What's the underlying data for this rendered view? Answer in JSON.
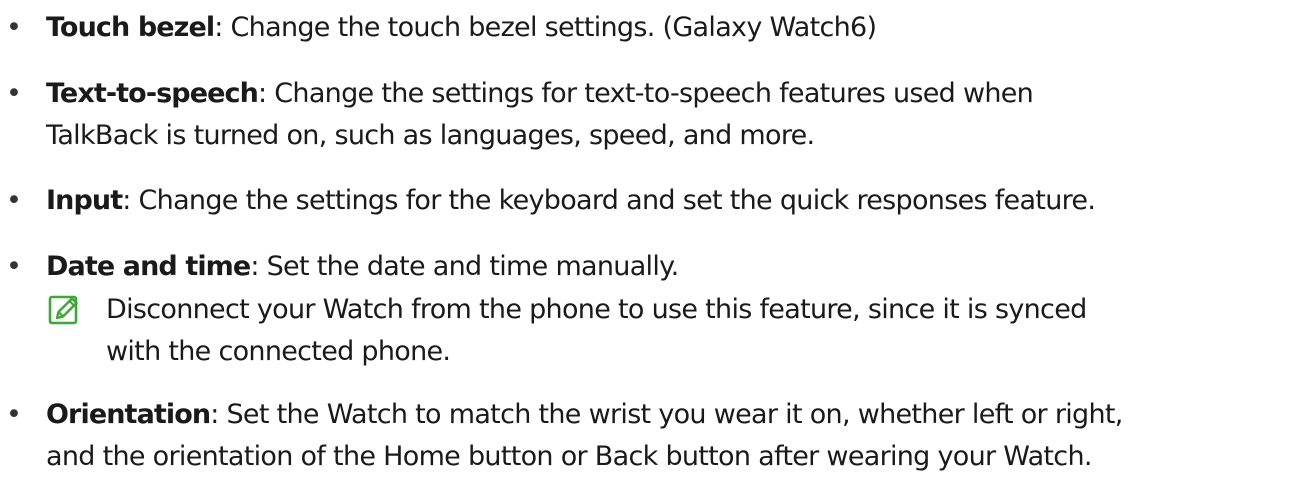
{
  "items": [
    {
      "term": "Touch bezel",
      "desc1": ": Change the touch bezel settings. (Galaxy Watch6)"
    },
    {
      "term": "Text-to-speech",
      "desc1": ": Change the settings for text-to-speech features used when",
      "desc2": "TalkBack is turned on, such as languages, speed, and more."
    },
    {
      "term": "Input",
      "desc1": ": Change the settings for the keyboard and set the quick responses feature."
    },
    {
      "term": "Date and time",
      "desc1": ": Set the date and time manually."
    },
    {
      "term": "Orientation",
      "desc1": ": Set the Watch to match the wrist you wear it on, whether left or right,",
      "desc2": "and the orientation of the Home button or Back button after wearing your Watch."
    }
  ],
  "note": {
    "icon": "note-pencil-icon",
    "icon_color": "#3aa935",
    "line1": "Disconnect your Watch from the phone to use this feature, since it is synced",
    "line2": "with the connected phone."
  },
  "bullet_char": "•"
}
